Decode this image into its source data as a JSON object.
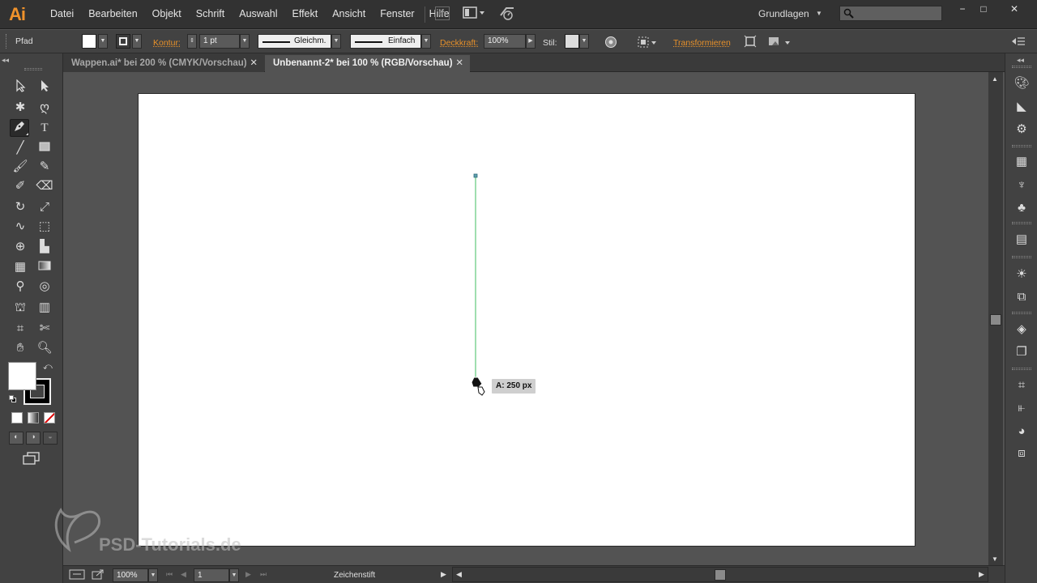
{
  "app": {
    "logo": "Ai",
    "menu": [
      "Datei",
      "Bearbeiten",
      "Objekt",
      "Schrift",
      "Auswahl",
      "Effekt",
      "Ansicht",
      "Fenster",
      "Hilfe"
    ],
    "bridge_label": "Br",
    "workspace": "Grundlagen",
    "search_placeholder": "",
    "window_buttons": [
      "−",
      "□",
      "✕"
    ]
  },
  "control_bar": {
    "object_type": "Pfad",
    "kontur_label": "Kontur:",
    "stroke_weight": "1 pt",
    "profile_label": "Gleichm.",
    "brush_label": "Einfach",
    "opacity_label": "Deckkraft:",
    "opacity_value": "100%",
    "style_label": "Stil:",
    "transform_label": "Transformieren"
  },
  "tabs": [
    {
      "label": "Wappen.ai* bei 200 % (CMYK/Vorschau)",
      "active": false
    },
    {
      "label": "Unbenannt-2* bei 100 % (RGB/Vorschau)",
      "active": true
    }
  ],
  "canvas": {
    "tooltip": "A: 250 px",
    "path_color": "#5fc87a"
  },
  "status_bar": {
    "zoom": "100%",
    "artboard_number": "1",
    "current_tool": "Zeichenstift"
  },
  "watermark": "PSD-Tutorials.de",
  "colors": {
    "accent": "#f0922b",
    "link": "#e8912a"
  }
}
